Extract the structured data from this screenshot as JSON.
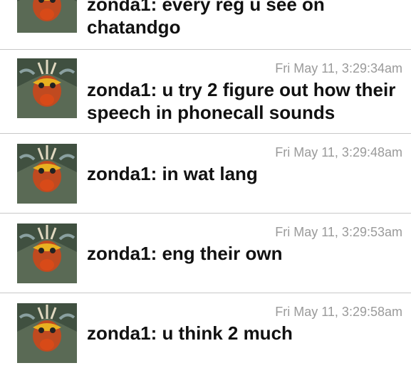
{
  "messages": [
    {
      "author": "zonda1",
      "text": "zonda1: every reg u see on chatandgo",
      "time": ""
    },
    {
      "author": "zonda1",
      "text": "zonda1: u try 2 figure out how their speech in phonecall sounds",
      "time": "Fri May 11, 3:29:34am"
    },
    {
      "author": "zonda1",
      "text": "zonda1: in wat lang",
      "time": "Fri May 11, 3:29:48am"
    },
    {
      "author": "zonda1",
      "text": "zonda1: eng their own",
      "time": "Fri May 11, 3:29:53am"
    },
    {
      "author": "zonda1",
      "text": "zonda1: u think 2 much",
      "time": "Fri May 11, 3:29:58am"
    }
  ],
  "colors": {
    "separator": "#c8c8c8",
    "timestamp": "#9a9a9a",
    "text": "#111111"
  }
}
